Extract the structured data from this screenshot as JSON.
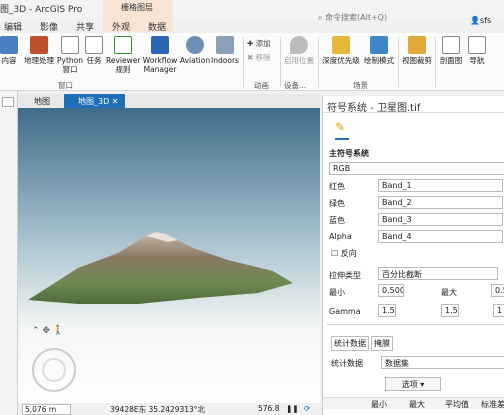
{
  "titlebar": {
    "title": "图_3D - ArcGIS Pro",
    "context_group": "栅格图层",
    "search_placeholder": "命令搜索(Alt+Q)",
    "user": "sfs"
  },
  "menu_tabs": [
    "编辑",
    "影像",
    "共享",
    "外观",
    "数据"
  ],
  "ribbon": {
    "buttons": [
      {
        "label": "内容",
        "icon": "contents-icon"
      },
      {
        "label": "地理处理",
        "icon": "toolbox-icon"
      },
      {
        "label": "Python\n窗口",
        "icon": "python-icon"
      },
      {
        "label": "任务",
        "icon": "tasks-icon"
      },
      {
        "label": "Reviewer\n规则",
        "icon": "reviewer-icon"
      },
      {
        "label": "Workflow\nManager",
        "icon": "workflow-icon"
      },
      {
        "label": "Aviation",
        "icon": "aviation-icon"
      },
      {
        "label": "Indoors",
        "icon": "indoors-icon"
      },
      {
        "label": "启用位置",
        "icon": "location-icon"
      },
      {
        "label": "深度优先级",
        "icon": "depth-icon"
      },
      {
        "label": "绘制模式",
        "icon": "draw-mode-icon"
      },
      {
        "label": "视图裁剪",
        "icon": "view-clip-icon"
      },
      {
        "label": "剖面图",
        "icon": "profile-icon"
      },
      {
        "label": "导航",
        "icon": "navigation-icon"
      }
    ],
    "small": {
      "add": "添加",
      "remove": "移除"
    },
    "groups": {
      "window": "窗口",
      "animation": "动画",
      "device": "设备...",
      "scene": "场景"
    }
  },
  "view": {
    "tabs": [
      {
        "label": "地图",
        "active": false
      },
      {
        "label": "地图_3D",
        "active": true
      }
    ],
    "scale": "5,076 m",
    "coords": "39428E东 35.2429313°北",
    "elevation": "576.8"
  },
  "panel": {
    "title": "符号系统 - 卫星图.tif",
    "section_title": "主符号系统",
    "renderer": "RGB",
    "bands": [
      {
        "label": "红色",
        "value": "Band_1"
      },
      {
        "label": "绿色",
        "value": "Band_2"
      },
      {
        "label": "蓝色",
        "value": "Band_3"
      },
      {
        "label": "Alpha",
        "value": "Band_4"
      }
    ],
    "invert_label": "反向",
    "stretch_label": "拉伸类型",
    "stretch_value": "百分比截断",
    "min_label": "最小",
    "min_value": "0.500",
    "max_label": "最大",
    "max_value": "0.5",
    "gamma_label": "Gamma",
    "gamma_values": [
      "1.5",
      "1.5",
      "1"
    ],
    "subtabs": [
      "统计数据",
      "掩膜"
    ],
    "stats_label": "统计数据",
    "stats_value": "数据集",
    "options_label": "选项",
    "table_headers": [
      "最小",
      "最大",
      "平均值",
      "标准差"
    ]
  },
  "colors": {
    "accent": "#1e6fb8",
    "context": "#f7e4d5"
  }
}
